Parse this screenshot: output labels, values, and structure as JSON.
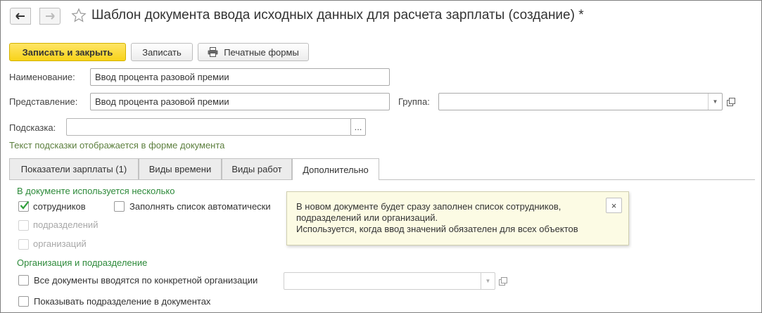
{
  "window": {
    "title": "Шаблон документа ввода исходных данных для расчета зарплаты (создание) *"
  },
  "toolbar": {
    "save_close_label": "Записать и закрыть",
    "save_label": "Записать",
    "print_label": "Печатные формы"
  },
  "form": {
    "name_label": "Наименование:",
    "name_value": "Ввод процента разовой премии",
    "repr_label": "Представление:",
    "repr_value": "Ввод процента разовой премии",
    "group_label": "Группа:",
    "group_value": "",
    "hint_label": "Подсказка:",
    "hint_value": "",
    "hint_button": "...",
    "hint_note": "Текст подсказки отображается в форме документа"
  },
  "tabs": [
    {
      "label": "Показатели зарплаты (1)"
    },
    {
      "label": "Виды времени"
    },
    {
      "label": "Виды работ"
    },
    {
      "label": "Дополнительно"
    }
  ],
  "active_tab": "Дополнительно",
  "additional": {
    "section_used": "В документе используется несколько",
    "employees": {
      "label": "сотрудников",
      "checked": true
    },
    "autofill": {
      "label": "Заполнять список автоматически",
      "checked": false
    },
    "departments": {
      "label": "подразделений",
      "checked": false
    },
    "organizations": {
      "label": "организаций",
      "checked": false
    },
    "section_org": "Организация и подразделение",
    "by_org": {
      "label": "Все документы вводятся по конкретной организации",
      "checked": false
    },
    "by_org_value": "",
    "show_dept": {
      "label": "Показывать подразделение в документах",
      "checked": false
    }
  },
  "tooltip": {
    "line1": "В новом документе будет сразу заполнен список сотрудников,",
    "line2": "подразделений или организаций.",
    "line3": "Используется, когда ввод значений обязателен для всех объектов",
    "close": "×"
  },
  "colors": {
    "primary_button": "#f8d31a",
    "section_green": "#2d8a3a",
    "hint_green": "#5c7f3e",
    "tooltip_bg": "#fcfbe4"
  }
}
